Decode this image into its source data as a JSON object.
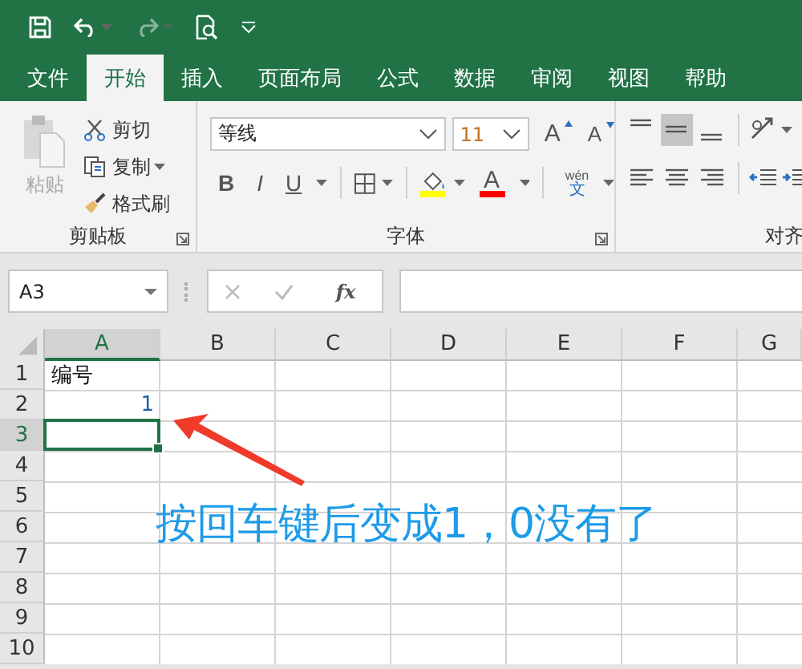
{
  "tabs": [
    {
      "label": "文件",
      "selected": false
    },
    {
      "label": "开始",
      "selected": true
    },
    {
      "label": "插入",
      "selected": false
    },
    {
      "label": "页面布局",
      "selected": false
    },
    {
      "label": "公式",
      "selected": false
    },
    {
      "label": "数据",
      "selected": false
    },
    {
      "label": "审阅",
      "selected": false
    },
    {
      "label": "视图",
      "selected": false
    },
    {
      "label": "帮助",
      "selected": false
    }
  ],
  "clipboard": {
    "paste": {
      "label": "粘贴",
      "disabled": true
    },
    "cut": "剪切",
    "copy": "复制",
    "format_painter": "格式刷",
    "group_label": "剪贴板"
  },
  "font": {
    "font_name": "等线",
    "font_size": "11",
    "grow": "A",
    "shrink": "A",
    "bold": "B",
    "italic": "I",
    "underline": "U",
    "font_color": "A",
    "phonetic_top": "wén",
    "phonetic_bottom": "文",
    "group_label": "字体"
  },
  "alignment": {
    "group_label": "对齐"
  },
  "formula_bar": {
    "name_box": "A3",
    "function_label": "fx"
  },
  "sheet": {
    "columns": [
      {
        "label": "A",
        "selected": true
      },
      {
        "label": "B",
        "selected": false
      },
      {
        "label": "C",
        "selected": false
      },
      {
        "label": "D",
        "selected": false
      },
      {
        "label": "E",
        "selected": false
      },
      {
        "label": "F",
        "selected": false
      },
      {
        "label": "G",
        "selected": false
      }
    ],
    "rows": [
      {
        "label": "1",
        "selected": false,
        "cells": [
          {
            "text": "编号",
            "kind": "text"
          }
        ]
      },
      {
        "label": "2",
        "selected": false,
        "cells": [
          {
            "text": "1",
            "kind": "number"
          }
        ]
      },
      {
        "label": "3",
        "selected": true
      },
      {
        "label": "4",
        "selected": false
      },
      {
        "label": "5",
        "selected": false
      },
      {
        "label": "6",
        "selected": false
      },
      {
        "label": "7",
        "selected": false
      },
      {
        "label": "8",
        "selected": false
      },
      {
        "label": "9",
        "selected": false
      },
      {
        "label": "10",
        "selected": false
      }
    ]
  },
  "annotation": {
    "text": "按回车键后变成1，0没有了"
  }
}
